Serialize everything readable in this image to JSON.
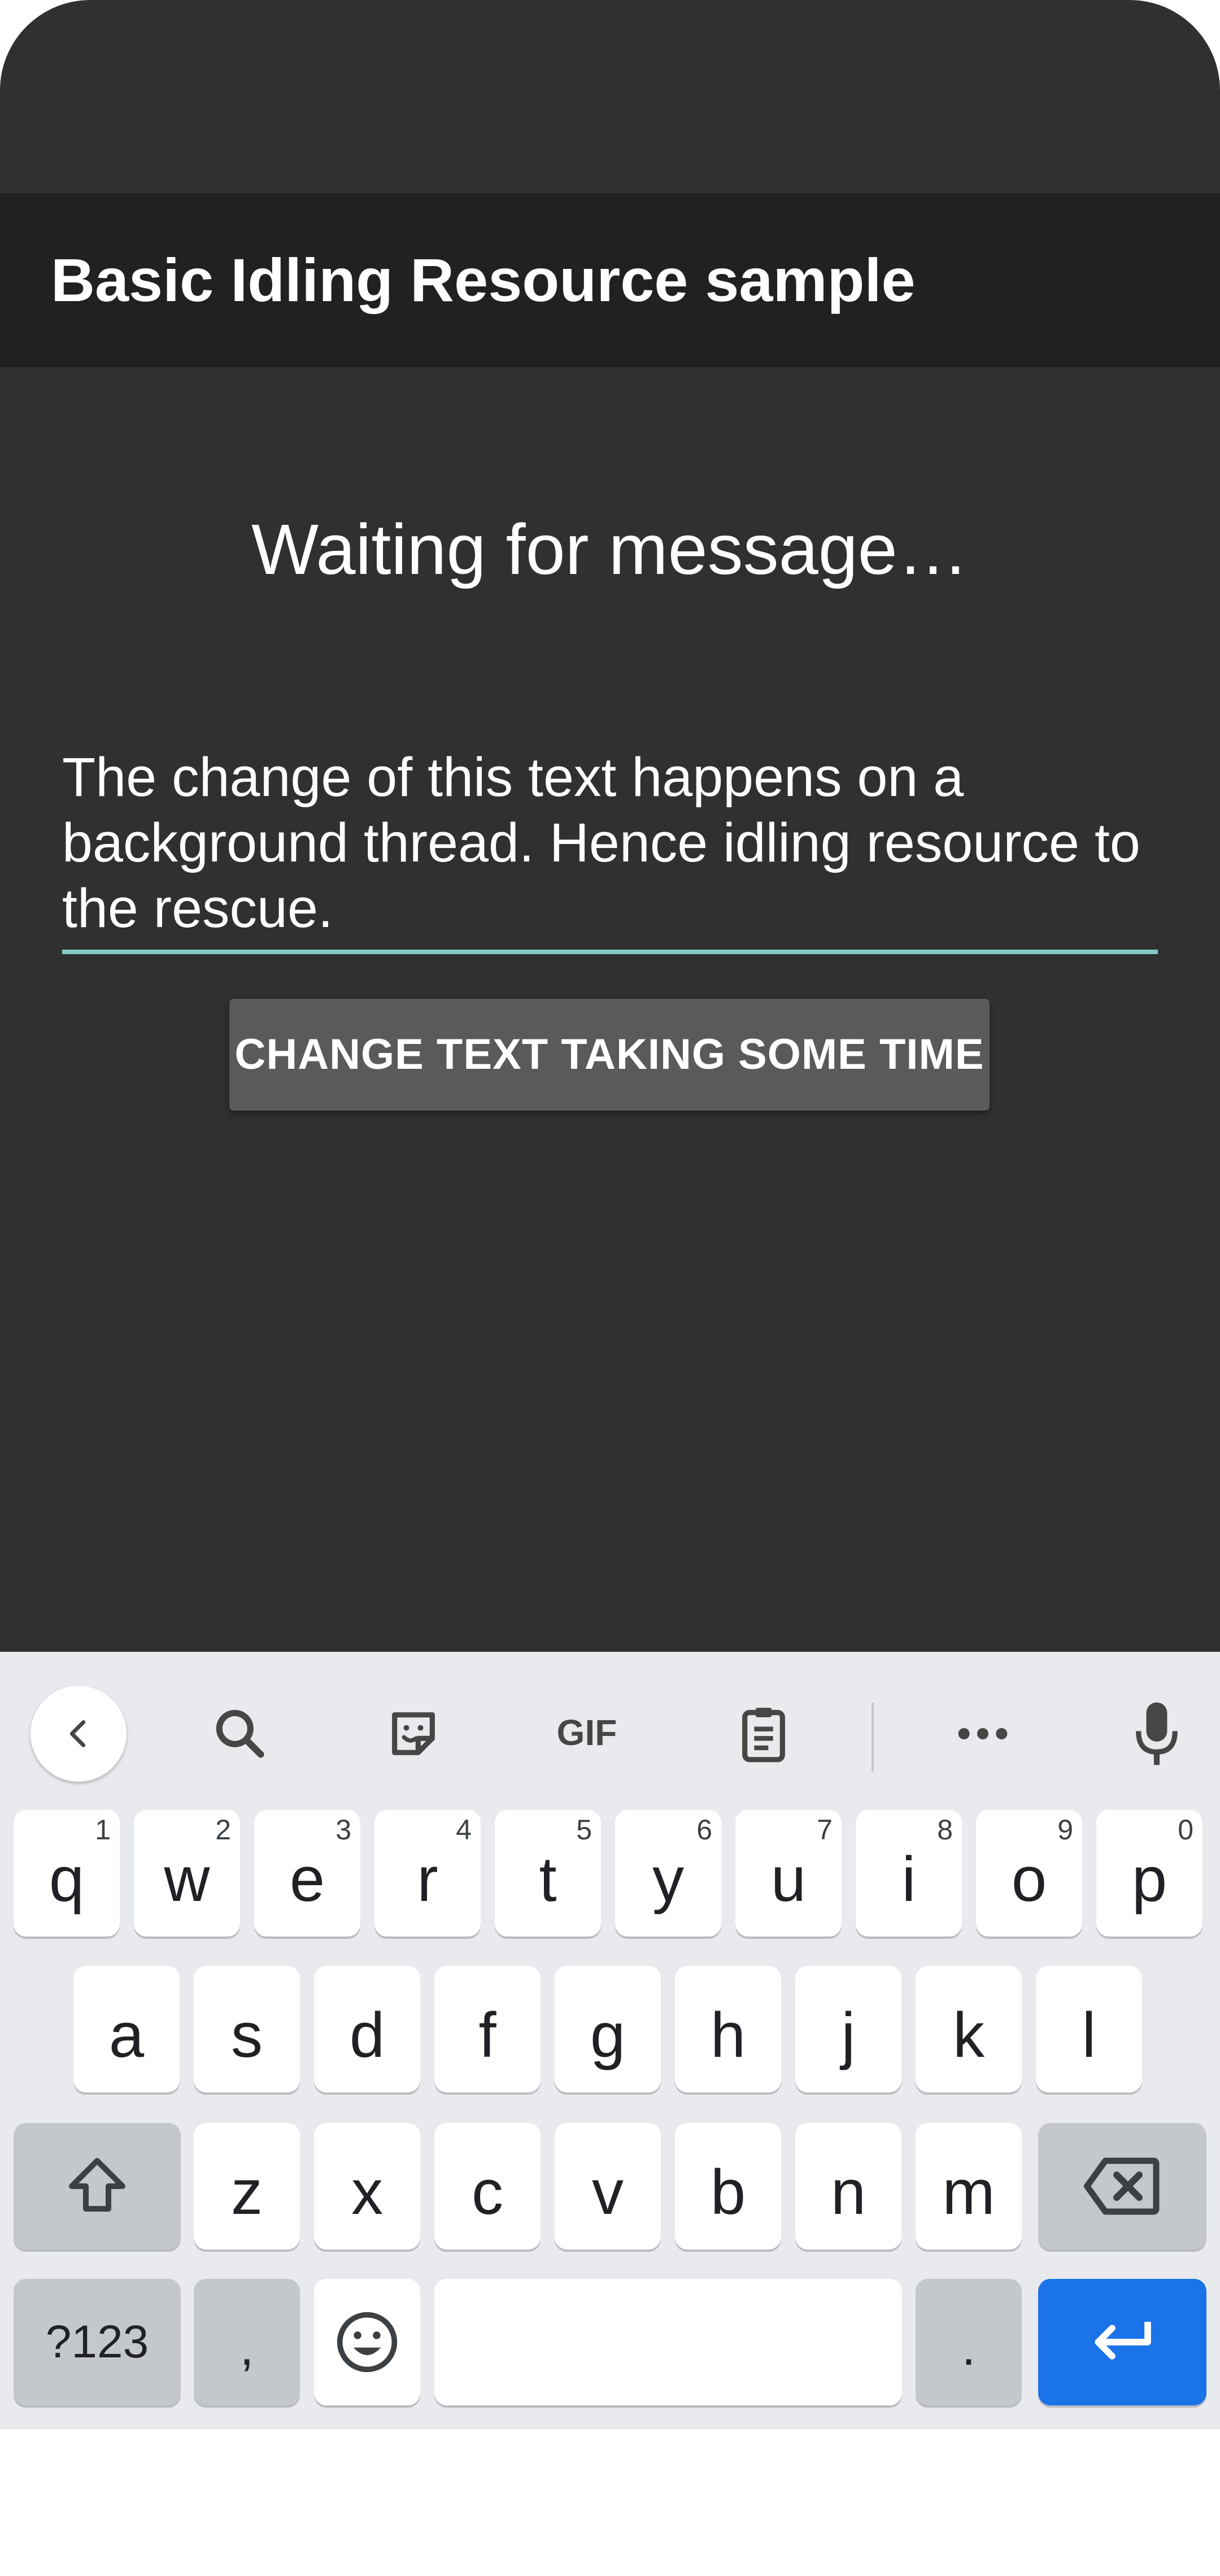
{
  "app": {
    "title": "Basic Idling Resource sample"
  },
  "main": {
    "message": "Waiting for message…",
    "input_value": "The change of this text happens on a background thread. Hence idling resource to the rescue.",
    "button_label": "CHANGE TEXT TAKING SOME TIME",
    "underline_color": "#7fcbc4"
  },
  "keyboard": {
    "toolbar": [
      "back-arrow-icon",
      "search-icon",
      "sticker-icon",
      "gif-icon",
      "clipboard-icon",
      "more-icon",
      "mic-icon"
    ],
    "gif_label": "GIF",
    "row1": [
      {
        "letter": "q",
        "num": "1"
      },
      {
        "letter": "w",
        "num": "2"
      },
      {
        "letter": "e",
        "num": "3"
      },
      {
        "letter": "r",
        "num": "4"
      },
      {
        "letter": "t",
        "num": "5"
      },
      {
        "letter": "y",
        "num": "6"
      },
      {
        "letter": "u",
        "num": "7"
      },
      {
        "letter": "i",
        "num": "8"
      },
      {
        "letter": "o",
        "num": "9"
      },
      {
        "letter": "p",
        "num": "0"
      }
    ],
    "row2": [
      "a",
      "s",
      "d",
      "f",
      "g",
      "h",
      "j",
      "k",
      "l"
    ],
    "row3": [
      "z",
      "x",
      "c",
      "v",
      "b",
      "n",
      "m"
    ],
    "symbols_label": "?123",
    "comma_label": ",",
    "period_label": ".",
    "enter_color": "#1a73e8"
  }
}
